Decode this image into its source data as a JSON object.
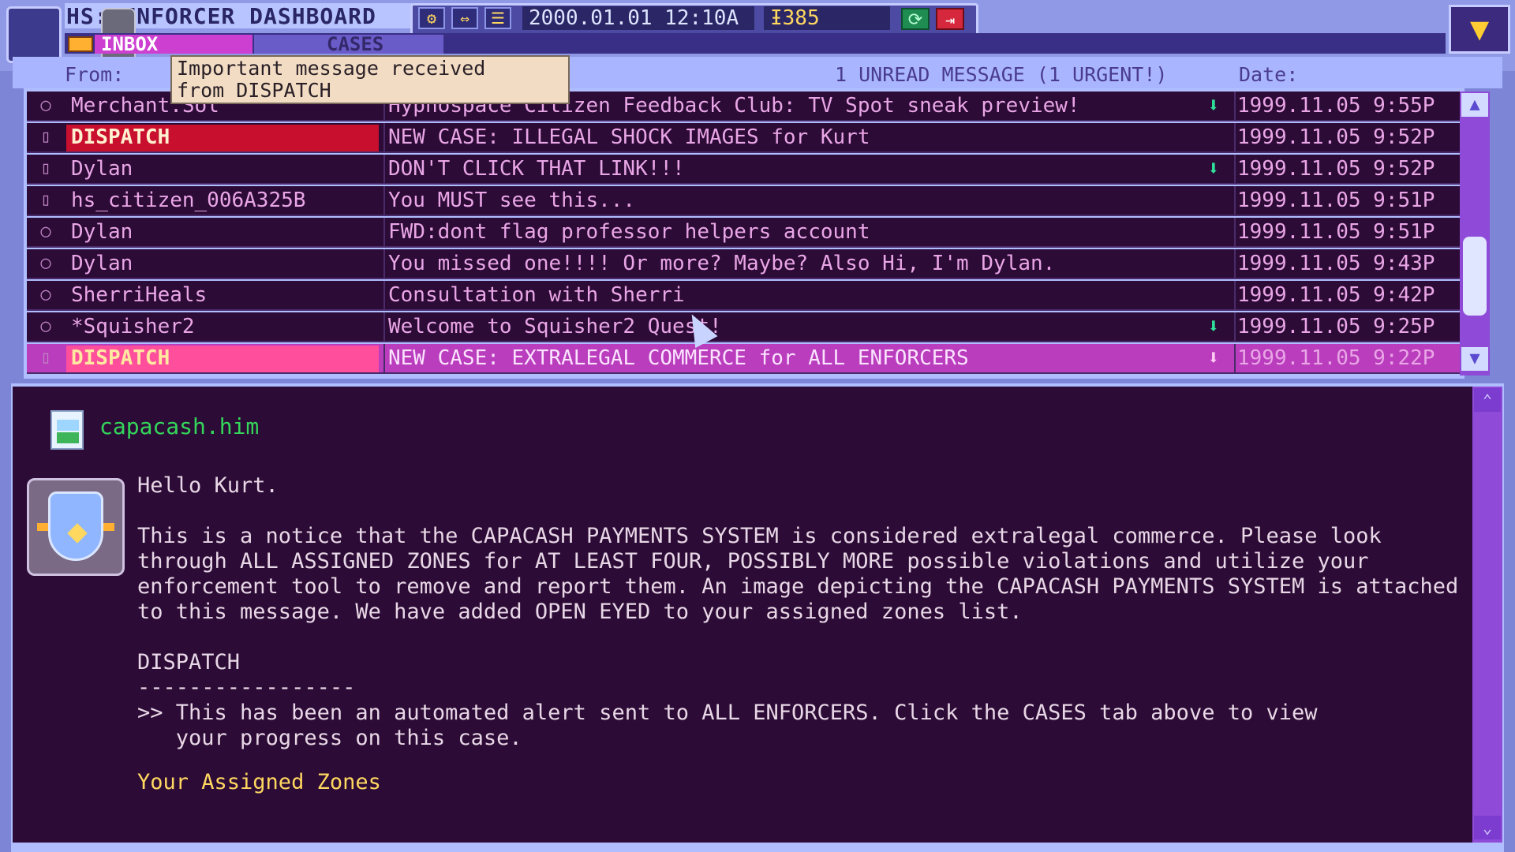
{
  "app": {
    "title": "HS: ENFORCER DASHBOARD",
    "clock": "2000.01.01  12:10A",
    "credits": "Ɨ385"
  },
  "toolbar": {
    "settings_icon": "gear-icon",
    "map_icon": "resize-icon",
    "menu_icon": "menu-icon",
    "refresh_icon": "refresh-icon",
    "logout_icon": "logout-icon",
    "minimize_icon": "triangle-down-icon"
  },
  "tabs": [
    {
      "label": "INBOX",
      "active": true
    },
    {
      "label": "CASES",
      "active": false
    }
  ],
  "list_header": {
    "from": "From:",
    "status": "1 UNREAD MESSAGE (1 URGENT!)",
    "date": "Date:"
  },
  "tooltip": {
    "line1": "Important message received",
    "line2": "from DISPATCH"
  },
  "messages": [
    {
      "from": "Merchant.Sol",
      "subject": "Hypnospace Citizen Feedback Club: TV Spot sneak preview!",
      "date": "1999.11.05 9:55P",
      "attachment": true,
      "urgent": false,
      "selected": false
    },
    {
      "from": "DISPATCH",
      "subject": "NEW CASE: ILLEGAL SHOCK IMAGES for Kurt",
      "date": "1999.11.05 9:52P",
      "attachment": false,
      "urgent": true,
      "selected": false
    },
    {
      "from": "Dylan",
      "subject": "DON'T CLICK THAT LINK!!!",
      "date": "1999.11.05 9:52P",
      "attachment": true,
      "urgent": false,
      "selected": false
    },
    {
      "from": "hs_citizen_006A325B",
      "subject": "You MUST see this...",
      "date": "1999.11.05 9:51P",
      "attachment": false,
      "urgent": false,
      "selected": false
    },
    {
      "from": "Dylan",
      "subject": "FWD:dont flag professor helpers account",
      "date": "1999.11.05 9:51P",
      "attachment": false,
      "urgent": false,
      "selected": false
    },
    {
      "from": "Dylan",
      "subject": "You missed one!!!! Or more? Maybe? Also Hi, I'm Dylan.",
      "date": "1999.11.05 9:43P",
      "attachment": false,
      "urgent": false,
      "selected": false
    },
    {
      "from": "SherriHeals",
      "subject": "Consultation with Sherri",
      "date": "1999.11.05 9:42P",
      "attachment": false,
      "urgent": false,
      "selected": false
    },
    {
      "from": "*Squisher2",
      "subject": "Welcome to Squisher2 Quest!",
      "date": "1999.11.05 9:25P",
      "attachment": true,
      "urgent": false,
      "selected": false
    },
    {
      "from": "DISPATCH",
      "subject": "NEW CASE: EXTRALEGAL COMMERCE for ALL ENFORCERS",
      "date": "1999.11.05 9:22P",
      "attachment": true,
      "urgent": false,
      "selected": true
    }
  ],
  "reading_pane": {
    "attachment_name": "capacash.him",
    "greeting": "Hello Kurt.",
    "body": "This is a notice that the CAPACASH PAYMENTS SYSTEM is considered extralegal commerce. Please look through ALL ASSIGNED ZONES for AT LEAST FOUR, POSSIBLY MORE possible violations and utilize your enforcement tool to remove and report them. An image depicting the CAPACASH PAYMENTS SYSTEM is attached to this message. We have added OPEN EYED to your assigned zones list.",
    "signature": "DISPATCH",
    "divider": "-----------------",
    "footer": ">> This has been an automated alert sent to ALL ENFORCERS. Click the CASES tab above to view\n   your progress on this case.",
    "zones_heading": "Your Assigned Zones"
  },
  "colors": {
    "list_bg": "#2c0b36",
    "urgent": "#c8102e",
    "selected_row": "#b93dbd",
    "selected_sender": "#ff4f9c",
    "attachment_arrow": "#2fe09a",
    "zones_heading": "#ffd860"
  }
}
